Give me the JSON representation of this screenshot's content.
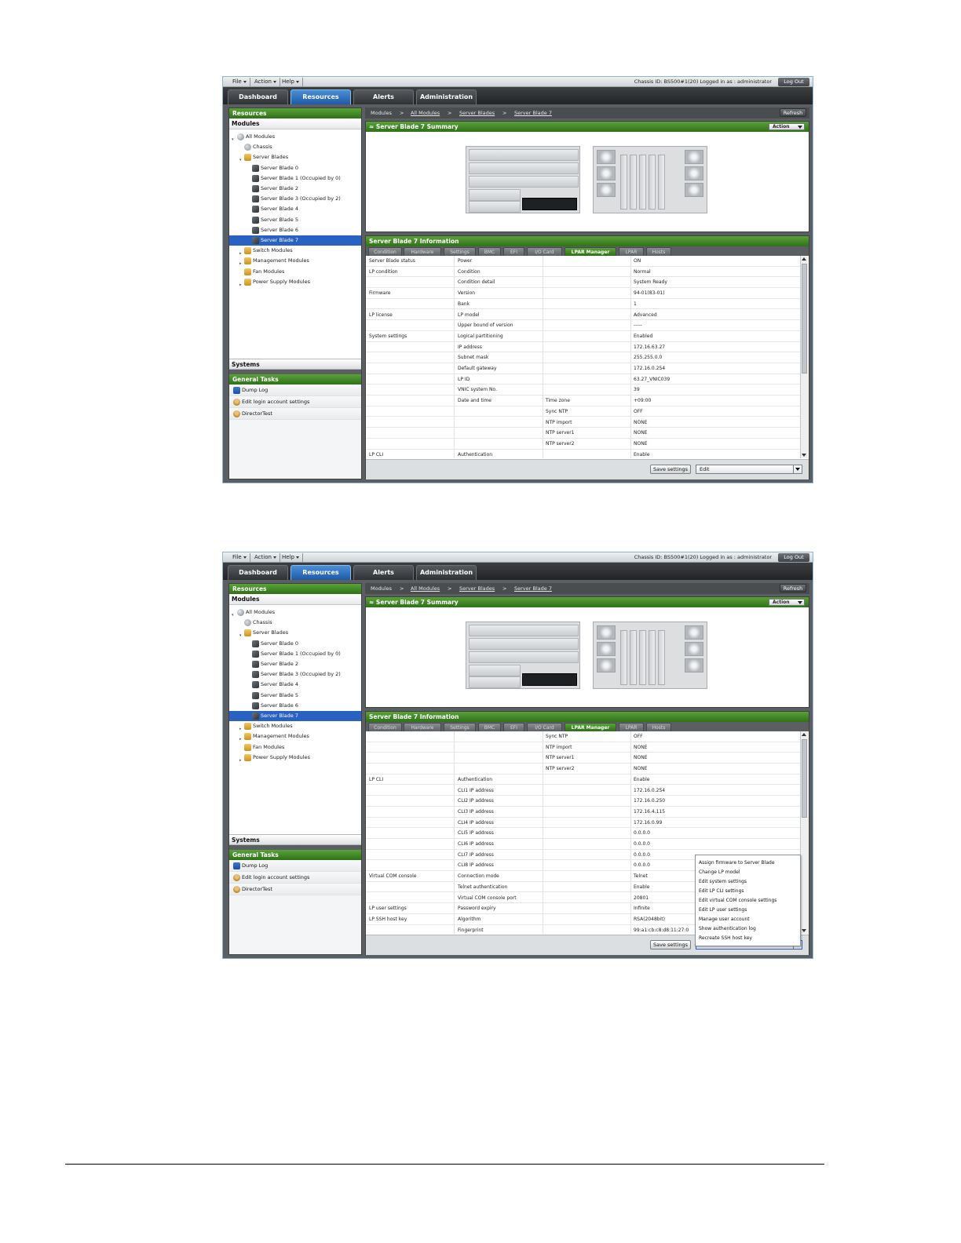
{
  "menu": {
    "file": "File",
    "action": "Action",
    "help": "Help"
  },
  "header": {
    "chassis_info": "Chassis ID: BS500#1(20) Logged in as : administrator",
    "logout": "Log Out"
  },
  "tabs": {
    "dashboard": "Dashboard",
    "resources": "Resources",
    "alerts": "Alerts",
    "administration": "Administration"
  },
  "left": {
    "resources_title": "Resources",
    "modules_title": "Modules",
    "tree": [
      "All Modules",
      "Chassis",
      "Server Blades",
      "Server Blade 0",
      "Server Blade 1 (Occupied by 0)",
      "Server Blade 2",
      "Server Blade 3 (Occupied by 2)",
      "Server Blade 4",
      "Server Blade 5",
      "Server Blade 6",
      "Server Blade 7",
      "Switch Modules",
      "Management Modules",
      "Fan Modules",
      "Power Supply Modules"
    ],
    "systems_title": "Systems",
    "tasks_title": "General Tasks",
    "tasks": [
      "Dump Log",
      "Edit login account settings",
      "DirectorTest"
    ]
  },
  "breadcrumb": {
    "modules": "Modules",
    "sep": ">",
    "all_modules": "All Modules",
    "server_blades": "Server Blades",
    "server_blade_7": "Server Blade 7"
  },
  "refresh": "Refresh",
  "summary": {
    "title": "Server Blade 7 Summary",
    "action": "Action",
    "collapse_glyph": "≈"
  },
  "info": {
    "title": "Server Blade 7 Information",
    "tabs": [
      "Condition",
      "Hardware",
      "Settings",
      "BMC",
      "EFI",
      "I/O Card",
      "LPAR Manager",
      "LPAR",
      "Hosts"
    ]
  },
  "grid1": [
    [
      "Server Blade status",
      "Power",
      "",
      "ON"
    ],
    [
      "LP condition",
      "Condition",
      "",
      "Normal"
    ],
    [
      "",
      "Condition detail",
      "",
      "System Ready"
    ],
    [
      "Firmware",
      "Version",
      "",
      "94-01(83-01)"
    ],
    [
      "",
      "Bank",
      "",
      "1"
    ],
    [
      "LP license",
      "LP model",
      "",
      "Advanced"
    ],
    [
      "",
      "Upper bound of version",
      "",
      "-----"
    ],
    [
      "System settings",
      "Logical partitioning",
      "",
      "Enabled"
    ],
    [
      "",
      "IP address",
      "",
      "172.16.63.27"
    ],
    [
      "",
      "Subnet mask",
      "",
      "255.255.0.0"
    ],
    [
      "",
      "Default gateway",
      "",
      "172.16.0.254"
    ],
    [
      "",
      "LP ID",
      "",
      "63.27_VNIC039"
    ],
    [
      "",
      "VNIC system No.",
      "",
      "39"
    ],
    [
      "",
      "Date and time",
      "Time zone",
      "+09:00"
    ],
    [
      "",
      "",
      "Sync NTP",
      "OFF"
    ],
    [
      "",
      "",
      "NTP import",
      "NONE"
    ],
    [
      "",
      "",
      "NTP server1",
      "NONE"
    ],
    [
      "",
      "",
      "NTP server2",
      "NONE"
    ],
    [
      "LP CLI",
      "Authentication",
      "",
      "Enable"
    ]
  ],
  "grid2": [
    [
      "",
      "",
      "Sync NTP",
      "OFF"
    ],
    [
      "",
      "",
      "NTP import",
      "NONE"
    ],
    [
      "",
      "",
      "NTP server1",
      "NONE"
    ],
    [
      "",
      "",
      "NTP server2",
      "NONE"
    ],
    [
      "LP CLI",
      "Authentication",
      "",
      "Enable"
    ],
    [
      "",
      "CLI1 IP address",
      "",
      "172.16.0.254"
    ],
    [
      "",
      "CLI2 IP address",
      "",
      "172.16.0.250"
    ],
    [
      "",
      "CLI3 IP address",
      "",
      "172.16.4.115"
    ],
    [
      "",
      "CLI4 IP address",
      "",
      "172.16.0.99"
    ],
    [
      "",
      "CLI5 IP address",
      "",
      "0.0.0.0"
    ],
    [
      "",
      "CLI6 IP address",
      "",
      "0.0.0.0"
    ],
    [
      "",
      "CLI7 IP address",
      "",
      "0.0.0.0"
    ],
    [
      "",
      "CLI8 IP address",
      "",
      "0.0.0.0"
    ],
    [
      "Virtual COM console",
      "Connection mode",
      "",
      "Telnet"
    ],
    [
      "",
      "Telnet authentication",
      "",
      "Enable"
    ],
    [
      "",
      "Virtual COM console port",
      "",
      "20801"
    ],
    [
      "LP user settings",
      "Password expiry",
      "",
      "Infinite"
    ],
    [
      "LP SSH host key",
      "Algorithm",
      "",
      "RSA(2048bit)"
    ],
    [
      "",
      "Fingerprint",
      "",
      "99:a1:cb:c8:d8:11:27:0"
    ]
  ],
  "bottom": {
    "save": "Save settings",
    "edit": "Edit"
  },
  "edit_menu": [
    "Assign firmware to Server Blade",
    "Change LP model",
    "Edit system settings",
    "Edit LP CLI settings",
    "Edit virtual COM console settings",
    "Edit LP user settings",
    "Manage user account",
    "Show authentication log",
    "Recreate SSH host key"
  ]
}
